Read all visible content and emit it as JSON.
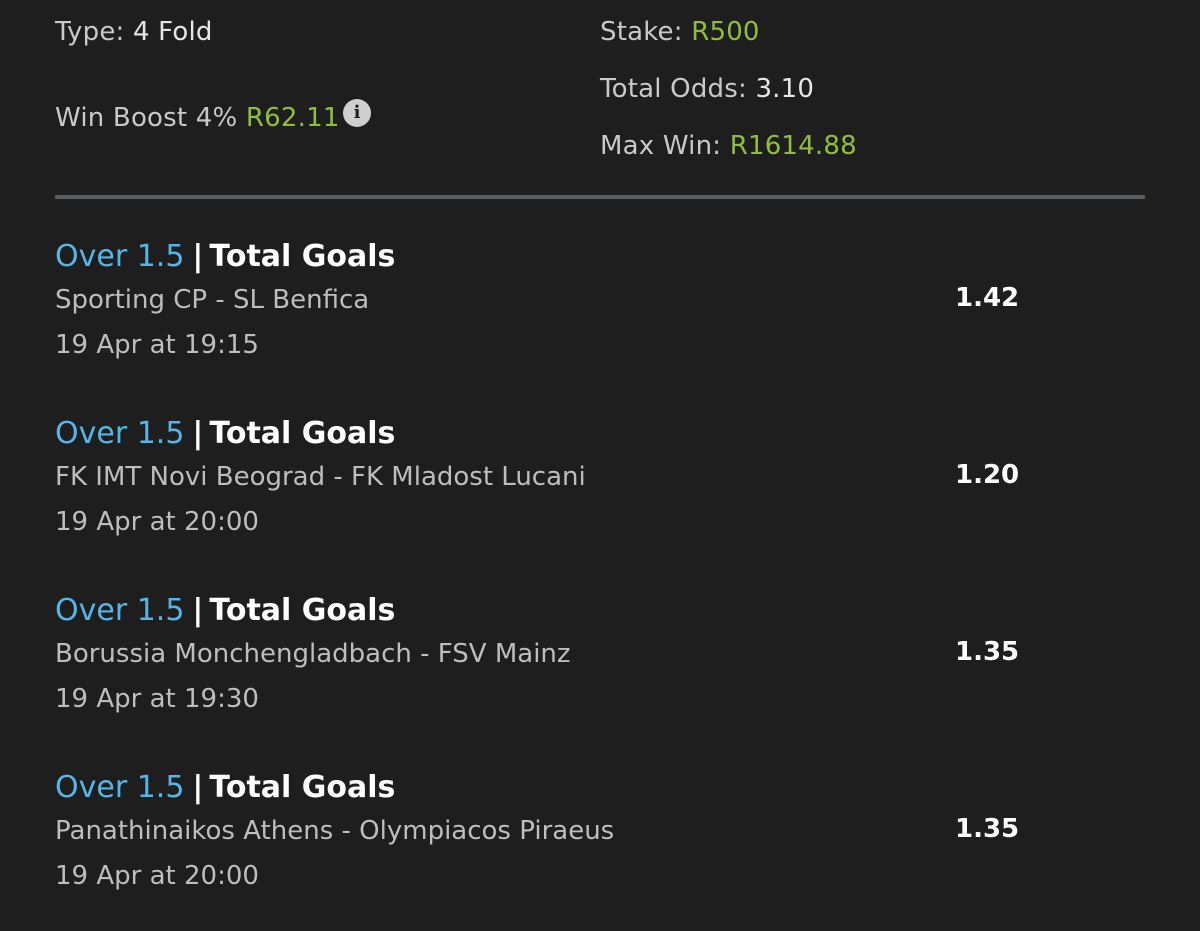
{
  "summary": {
    "type_label": "Type:",
    "type_value": "4 Fold",
    "win_boost_label": "Win Boost 4%",
    "win_boost_value": "R62.11",
    "info_icon": "info-icon",
    "stake_label": "Stake:",
    "stake_value": "R500",
    "total_odds_label": "Total Odds:",
    "total_odds_value": "3.10",
    "max_win_label": "Max Win:",
    "max_win_value": "R1614.88"
  },
  "selections": [
    {
      "pick": "Over 1.5",
      "separator": "|",
      "market": "Total Goals",
      "match": "Sporting CP - SL Benfica",
      "time": "19 Apr at 19:15",
      "odds": "1.42"
    },
    {
      "pick": "Over 1.5",
      "separator": "|",
      "market": "Total Goals",
      "match": "FK IMT Novi Beograd - FK Mladost Lucani",
      "time": "19 Apr at 20:00",
      "odds": "1.20"
    },
    {
      "pick": "Over 1.5",
      "separator": "|",
      "market": "Total Goals",
      "match": "Borussia Monchengladbach - FSV Mainz",
      "time": "19 Apr at 19:30",
      "odds": "1.35"
    },
    {
      "pick": "Over 1.5",
      "separator": "|",
      "market": "Total Goals",
      "match": "Panathinaikos Athens - Olympiacos Piraeus",
      "time": "19 Apr at 20:00",
      "odds": "1.35"
    }
  ],
  "colors": {
    "background": "#1e1e1e",
    "accent_green": "#8fbf3a",
    "pick_blue": "#55b5e8",
    "divider": "#5a5d60"
  }
}
